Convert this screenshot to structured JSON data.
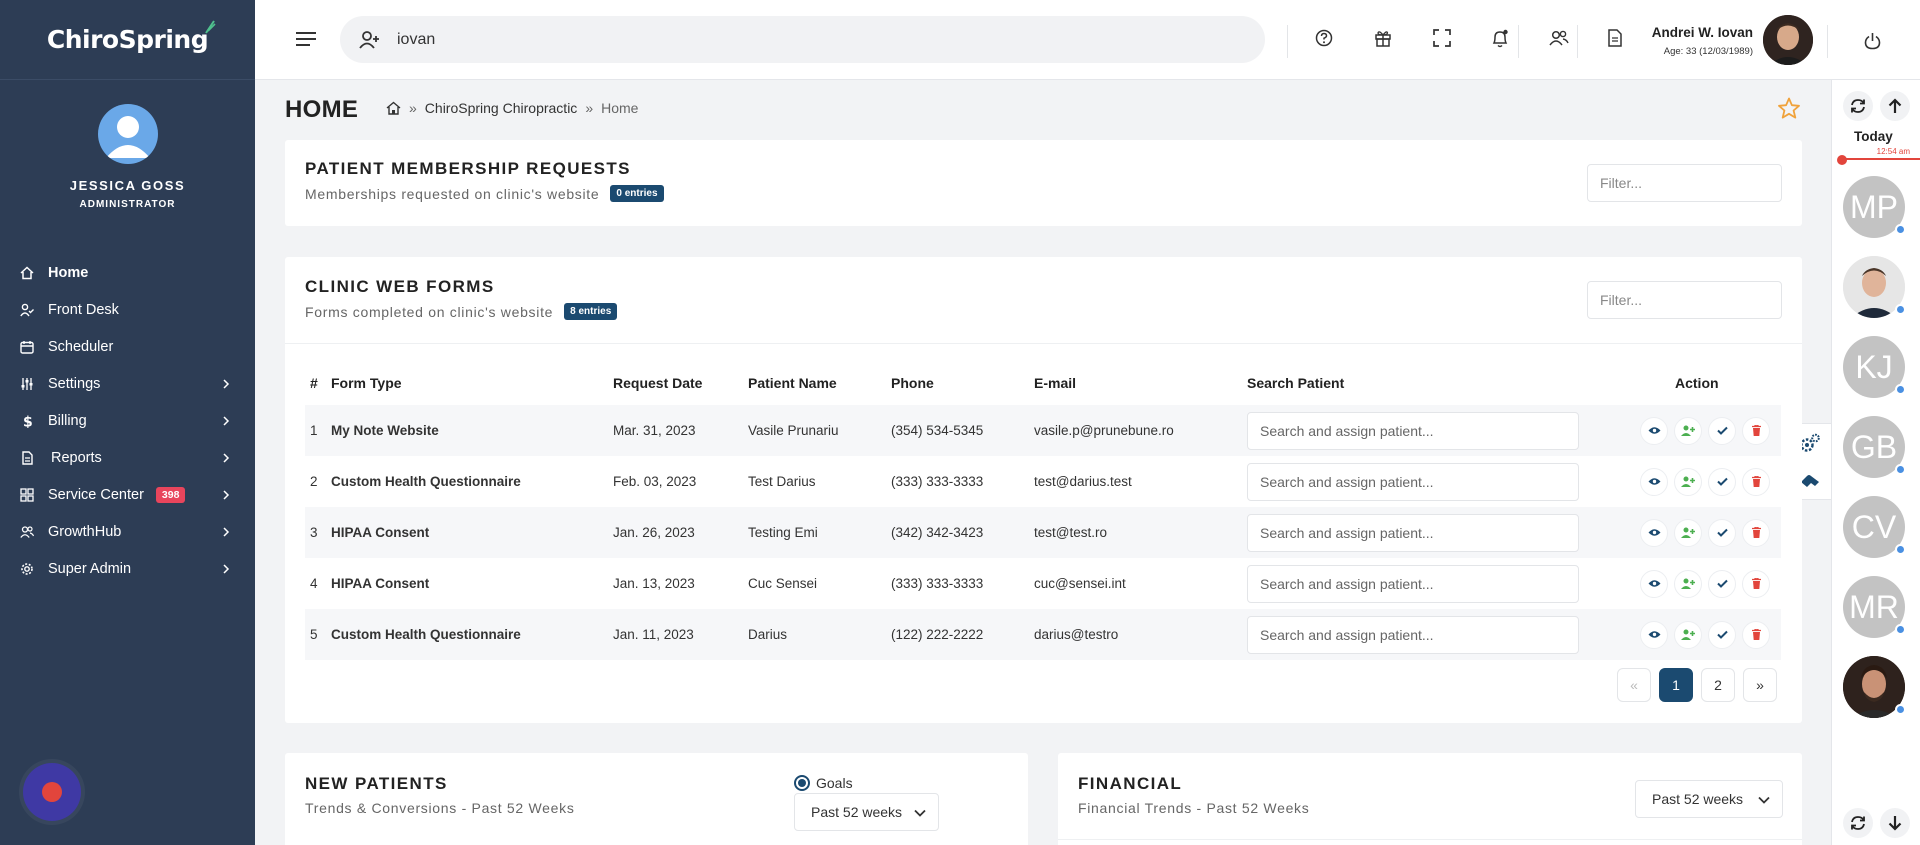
{
  "brand": {
    "name": "ChiroSpring"
  },
  "sidebar": {
    "profile": {
      "name": "JESSICA GOSS",
      "role": "ADMINISTRATOR"
    },
    "items": [
      {
        "label": "Home",
        "icon": "home-icon",
        "active": true
      },
      {
        "label": "Front Desk",
        "icon": "user-check-icon"
      },
      {
        "label": "Scheduler",
        "icon": "calendar-icon"
      },
      {
        "label": "Settings",
        "icon": "sliders-icon"
      },
      {
        "label": "Billing",
        "icon": "dollar-icon"
      },
      {
        "label": "Reports",
        "icon": "document-icon"
      },
      {
        "label": "Service Center",
        "icon": "grid-icon",
        "badge": "398"
      },
      {
        "label": "GrowthHub",
        "icon": "users-icon"
      },
      {
        "label": "Super Admin",
        "icon": "gear-icon"
      }
    ]
  },
  "topbar": {
    "search_value": "iovan",
    "user": {
      "name": "Andrei W. Iovan",
      "age": "Age: 33 (12/03/1989)"
    }
  },
  "main": {
    "title": "HOME",
    "breadcrumb": [
      "ChiroSpring Chiropractic",
      "Home"
    ]
  },
  "membership": {
    "title": "PATIENT MEMBERSHIP REQUESTS",
    "subtitle": "Memberships requested on clinic's website",
    "badge": "0 entries",
    "filter_placeholder": "Filter..."
  },
  "webforms": {
    "title": "CLINIC WEB FORMS",
    "subtitle": "Forms completed on clinic's website",
    "badge": "8 entries",
    "filter_placeholder": "Filter...",
    "columns": [
      "#",
      "Form Type",
      "Request Date",
      "Patient Name",
      "Phone",
      "E-mail",
      "Search Patient",
      "Action"
    ],
    "assign_placeholder": "Search and assign patient...",
    "rows": [
      {
        "idx": "1",
        "form": "My Note Website",
        "date": "Mar. 31, 2023",
        "patient": "Vasile Prunariu",
        "phone": "(354) 534-5345",
        "email": "vasile.p@prunebune.ro"
      },
      {
        "idx": "2",
        "form": "Custom Health Questionnaire",
        "date": "Feb. 03, 2023",
        "patient": "Test Darius",
        "phone": "(333) 333-3333",
        "email": "test@darius.test"
      },
      {
        "idx": "3",
        "form": "HIPAA Consent",
        "date": "Jan. 26, 2023",
        "patient": "Testing Emi",
        "phone": "(342) 342-3423",
        "email": "test@test.ro"
      },
      {
        "idx": "4",
        "form": "HIPAA Consent",
        "date": "Jan. 13, 2023",
        "patient": "Cuc Sensei",
        "phone": "(333) 333-3333",
        "email": "cuc@sensei.int"
      },
      {
        "idx": "5",
        "form": "Custom Health Questionnaire",
        "date": "Jan. 11, 2023",
        "patient": "Darius",
        "phone": "(122) 222-2222",
        "email": "darius@testro"
      }
    ],
    "pager": {
      "prev": "«",
      "pages": [
        "1",
        "2"
      ],
      "next": "»",
      "current": "1"
    }
  },
  "new_patients": {
    "title": "NEW PATIENTS",
    "subtitle": "Trends & Conversions - Past 52 Weeks",
    "goals_label": "Goals",
    "select_value": "Past 52 weeks"
  },
  "financial": {
    "title": "FINANCIAL",
    "subtitle": "Financial Trends - Past 52 Weeks",
    "select_value": "Past 52 weeks"
  },
  "rail": {
    "today": "Today",
    "time": "12:54 am",
    "avatars": [
      {
        "initials": "MP",
        "color": "#c3c3c3"
      },
      {
        "initials": "",
        "photo": true
      },
      {
        "initials": "KJ",
        "color": "#c3c3c3"
      },
      {
        "initials": "GB",
        "color": "#c3c3c3"
      },
      {
        "initials": "CV",
        "color": "#c3c3c3"
      },
      {
        "initials": "MR",
        "color": "#c3c3c3"
      },
      {
        "initials": "",
        "photo": true
      }
    ]
  },
  "colors": {
    "sidebar": "#2d3d55",
    "accent": "#1b4a70",
    "danger": "#e2453c",
    "badge": "#e8455c"
  }
}
